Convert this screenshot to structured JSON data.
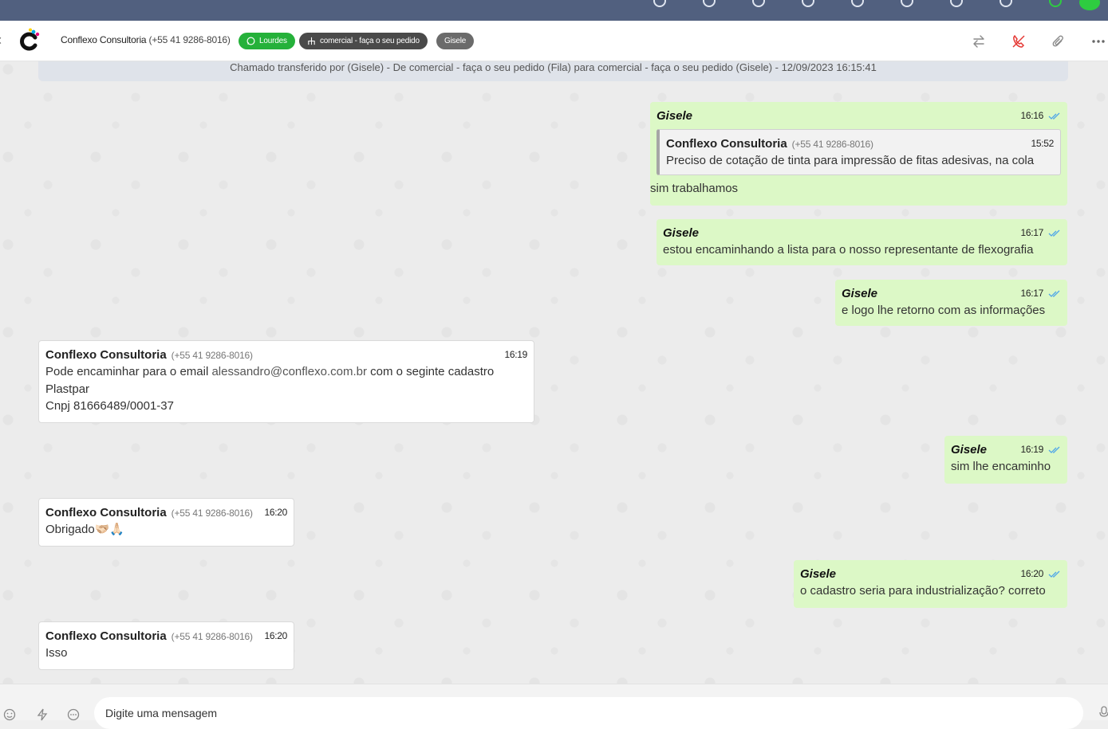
{
  "colors": {
    "topbar": "#51607f",
    "outgoing_bubble": "#dcf8c6",
    "incoming_bubble": "#ffffff",
    "whatsapp_green": "#25b13a",
    "tick_blue": "#4fa6e8",
    "call_red": "#e53935"
  },
  "header": {
    "contact_name": "Conflexo Consultoria",
    "contact_phone": "(+55 41 9286-8016)",
    "tags": {
      "channel": "Lourdes",
      "queue": "comercial - faça o seu pedido",
      "agent": "Gisele"
    },
    "icons": [
      "back-chevron-icon",
      "transfer-icon",
      "end-call-icon",
      "attachment-icon",
      "more-options-icon"
    ]
  },
  "system_message": "Chamado transferido por (Gisele) - De comercial - faça o seu pedido (Fila) para comercial - faça o seu pedido (Gisele) - 12/09/2023 16:15:41",
  "messages": [
    {
      "direction": "out",
      "sender": "Gisele",
      "time": "16:16",
      "quote": {
        "sender": "Conflexo Consultoria",
        "phone": "(+55 41 9286-8016)",
        "time": "15:52",
        "text": "Preciso de cotação de tinta para impressão de fitas adesivas, na cola"
      },
      "text": "sim trabalhamos"
    },
    {
      "direction": "out",
      "sender": "Gisele",
      "time": "16:17",
      "text": "estou encaminhando a lista para o nosso representante de flexografia"
    },
    {
      "direction": "out",
      "sender": "Gisele",
      "time": "16:17",
      "text": "e logo lhe retorno com as informações"
    },
    {
      "direction": "in",
      "sender": "Conflexo Consultoria",
      "phone": "(+55 41 9286-8016)",
      "time": "16:19",
      "line1_prefix": "Pode encaminhar para o email ",
      "email": "alessandro@conflexo.com.br",
      "line1_suffix": " com o seginte cadastro",
      "line2": "Plastpar",
      "line3": "Cnpj 81666489/0001-37"
    },
    {
      "direction": "out",
      "sender": "Gisele",
      "time": "16:19",
      "text": "sim lhe encaminho"
    },
    {
      "direction": "in",
      "sender": "Conflexo Consultoria",
      "phone": "(+55 41 9286-8016)",
      "time": "16:20",
      "text": "Obrigado🫱🏻‍🫲🏼🙏🏻"
    },
    {
      "direction": "out",
      "sender": "Gisele",
      "time": "16:20",
      "text": "o cadastro seria para industrialização? correto"
    },
    {
      "direction": "in",
      "sender": "Conflexo Consultoria",
      "phone": "(+55 41 9286-8016)",
      "time": "16:20",
      "text": "Isso"
    }
  ],
  "composer": {
    "placeholder": "Digite uma mensagem",
    "icons": [
      "emoji-icon",
      "quick-reply-icon",
      "more-icon",
      "mic-icon"
    ]
  }
}
